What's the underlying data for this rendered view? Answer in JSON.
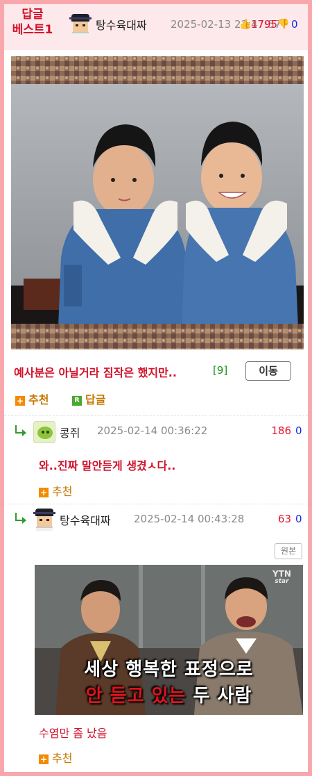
{
  "header": {
    "badge": "답글\n베스트1",
    "author": "탕수육대짜",
    "date": "2025-02-13 22:47:57",
    "likes": "1795",
    "dislikes": "0"
  },
  "post": {
    "image_alt": "two boys in denim jackets",
    "title": "예사분은 아닐거라 짐작은 했지만..",
    "comment_count": "[9]",
    "move_button": "이동",
    "recommend": "추천",
    "reply": "답글"
  },
  "comments": [
    {
      "author": "콩쥐",
      "date": "2025-02-14 00:36:22",
      "likes": "186",
      "dislikes": "0",
      "text": "와..진짜 말안듣게 생겼ㅅ다..",
      "recommend": "추천"
    },
    {
      "author": "탕수육대짜",
      "date": "2025-02-14 00:43:28",
      "likes": "63",
      "dislikes": "0",
      "original_button": "원본",
      "clip_logo": "YTN",
      "clip_logo_sub": "star",
      "clip_line1": "세상 행복한 표정으로",
      "clip_line2_red": "안 듣고 있는",
      "clip_line2_white": " 두 사람",
      "text": "수염만 좀 났음",
      "recommend": "추천"
    }
  ],
  "colors": {
    "frame": "#f8a8ad",
    "header_bg": "#fde9eb",
    "accent_red": "#d0122a",
    "like_red": "#e8132f",
    "dislike_blue": "#1a2bd6",
    "recommend_orange": "#c77500"
  },
  "icons": [
    "avatar-man-pixel",
    "avatar-alien",
    "thumbs-up-icon",
    "thumbs-down-icon",
    "reply-arrow-icon",
    "plus-icon",
    "reply-r-icon"
  ]
}
